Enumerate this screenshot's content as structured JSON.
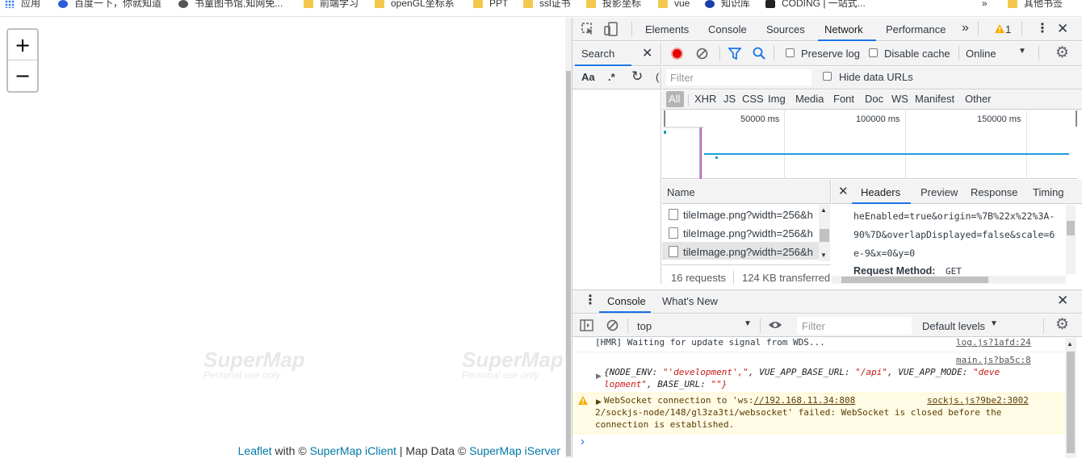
{
  "bookmarks": [
    {
      "label": "应用",
      "icon": "apps-grid-icon"
    },
    {
      "label": "百度一下，你就知道",
      "icon": "baidu-paw-icon"
    },
    {
      "label": "书童图书馆,知网免...",
      "icon": "globe-icon"
    },
    {
      "label": "前端学习",
      "icon": "folder-icon"
    },
    {
      "label": "openGL坐标系",
      "icon": "folder-icon"
    },
    {
      "label": "PPT",
      "icon": "folder-icon"
    },
    {
      "label": "ssl证书",
      "icon": "folder-icon"
    },
    {
      "label": "投影坐标",
      "icon": "folder-icon"
    },
    {
      "label": "vue",
      "icon": "folder-icon"
    },
    {
      "label": "知识库",
      "icon": "x-logo-icon"
    },
    {
      "label": "CODING | 一站式...",
      "icon": "coding-logo-icon"
    },
    {
      "label": "»",
      "icon": ""
    },
    {
      "label": "其他书签",
      "icon": "folder-icon"
    }
  ],
  "map": {
    "zoom_in": "+",
    "zoom_out": "−",
    "watermark_title": "SuperMap",
    "watermark_sub": "Personal use only",
    "attribution": {
      "leaflet": "Leaflet",
      "with": " with © ",
      "client": "SuperMap iClient",
      "mapdata": " | Map Data © ",
      "server": "SuperMap iServer"
    }
  },
  "devtools": {
    "tabs": [
      "Elements",
      "Console",
      "Sources",
      "Network",
      "Performance"
    ],
    "active_tab": "Network",
    "more_tabs": "»",
    "warning_count": "1",
    "search_label": "Search",
    "network": {
      "preserve_log": "Preserve log",
      "disable_cache": "Disable cache",
      "throttle": "Online",
      "filter_placeholder": "Filter",
      "hide_data_urls": "Hide data URLs",
      "types": [
        "All",
        "XHR",
        "JS",
        "CSS",
        "Img",
        "Media",
        "Font",
        "Doc",
        "WS",
        "Manifest",
        "Other"
      ],
      "timeline_ticks": [
        "50000 ms",
        "100000 ms",
        "150000 ms"
      ],
      "name_header": "Name",
      "requests": [
        "tileImage.png?width=256&h",
        "tileImage.png?width=256&h",
        "tileImage.png?width=256&h"
      ],
      "summary_requests": "16 requests",
      "summary_transferred": "124 KB transferred",
      "detail_tabs": [
        "Headers",
        "Preview",
        "Response",
        "Timing"
      ],
      "detail_active": "Headers",
      "detail_lines": [
        "heEnabled=true&origin=%7B%22x%22%3A-",
        "90%7D&overlapDisplayed=false&scale=6",
        "e-9&x=0&y=0"
      ],
      "request_method_label": "Request Method:",
      "request_method_value": "GET"
    },
    "drawer": {
      "tabs": [
        "Console",
        "What's New"
      ],
      "context": "top",
      "filter_placeholder": "Filter",
      "levels": "Default levels",
      "messages": [
        {
          "text": "[HMR] Waiting for update signal from WDS...",
          "source": "log.js?1afd:24"
        },
        {
          "source": "main.js?ba5c:8"
        },
        {
          "warn_prefix": "WebSocket connection to 'ws:",
          "warn_link": "//192.168.11.34:808",
          "source": "sockjs.js?9be2:3002",
          "line2": "2/sockjs-node/148/gl3za3ti/websocket' failed: WebSocket is closed before the",
          "line3": "connection is established."
        }
      ],
      "obj_open": "{NODE_ENV: ",
      "obj_env_val": "\"'development',\"",
      "obj_base_key": ", VUE_APP_BASE_URL: ",
      "obj_base_val": "\"/api\"",
      "obj_mode_key": ", VUE_APP_MODE: ",
      "obj_mode_val": "\"deve",
      "obj_line2_val": "lopment\"",
      "obj_line2_key": ", BASE_URL: ",
      "obj_line2_val2": "\"\"}",
      "prompt": "›"
    }
  }
}
